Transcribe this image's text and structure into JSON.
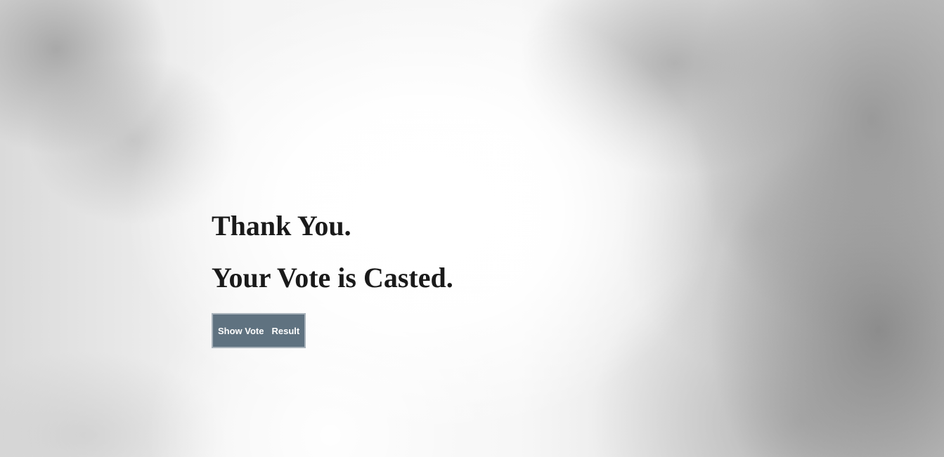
{
  "page": {
    "heading_line_1": "Thank You.",
    "heading_line_2": "Your Vote is Casted."
  },
  "button": {
    "label_part_1": "Show Vote",
    "label_part_2": "Result"
  },
  "colors": {
    "button_background": "#5f7280",
    "heading_text": "#1a1a1a",
    "button_text": "#ffffff"
  }
}
